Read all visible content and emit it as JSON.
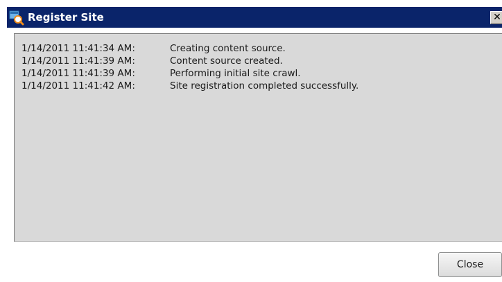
{
  "window": {
    "title": "Register Site",
    "close_glyph": "✕",
    "icon": "magnifier-site-icon"
  },
  "log": {
    "entries": [
      {
        "timestamp": "1/14/2011 11:41:34 AM:",
        "message": "Creating content source."
      },
      {
        "timestamp": "1/14/2011 11:41:39 AM:",
        "message": "Content source created."
      },
      {
        "timestamp": "1/14/2011 11:41:39 AM:",
        "message": "Performing initial site crawl."
      },
      {
        "timestamp": "1/14/2011 11:41:42 AM:",
        "message": "Site registration completed successfully."
      }
    ]
  },
  "buttons": {
    "close_label": "Close"
  },
  "colors": {
    "titlebar": "#0a246a",
    "log_background": "#d9d9d9"
  }
}
